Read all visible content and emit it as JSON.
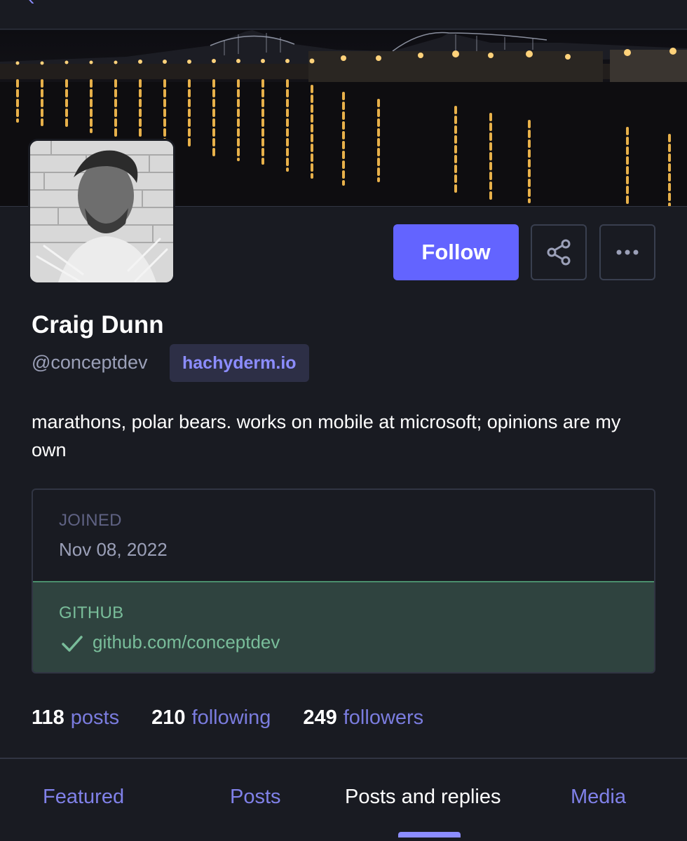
{
  "nav": {
    "back_label": "‹"
  },
  "profile": {
    "display_name": "Craig Dunn",
    "handle": "@conceptdev",
    "domain": "hachyderm.io",
    "bio": "marathons, polar bears. works on mobile at microsoft; opinions are my own"
  },
  "actions": {
    "follow_label": "Follow",
    "share_icon": "share-icon",
    "more_icon": "more-icon"
  },
  "fields": {
    "joined": {
      "label": "JOINED",
      "value": "Nov 08, 2022"
    },
    "github": {
      "label": "GITHUB",
      "value": "github.com/conceptdev",
      "verified": true
    }
  },
  "counts": {
    "posts": {
      "number": "118",
      "label": "posts"
    },
    "following": {
      "number": "210",
      "label": "following"
    },
    "followers": {
      "number": "249",
      "label": "followers"
    }
  },
  "tabs": [
    {
      "label": "Featured",
      "active": false
    },
    {
      "label": "Posts",
      "active": false
    },
    {
      "label": "Posts and replies",
      "active": true
    },
    {
      "label": "Media",
      "active": false
    }
  ],
  "colors": {
    "background": "#191b22",
    "accent": "#6364ff",
    "link": "#8c8dff",
    "verified_green": "#79bd9a",
    "verified_bg": "#2f433f"
  }
}
